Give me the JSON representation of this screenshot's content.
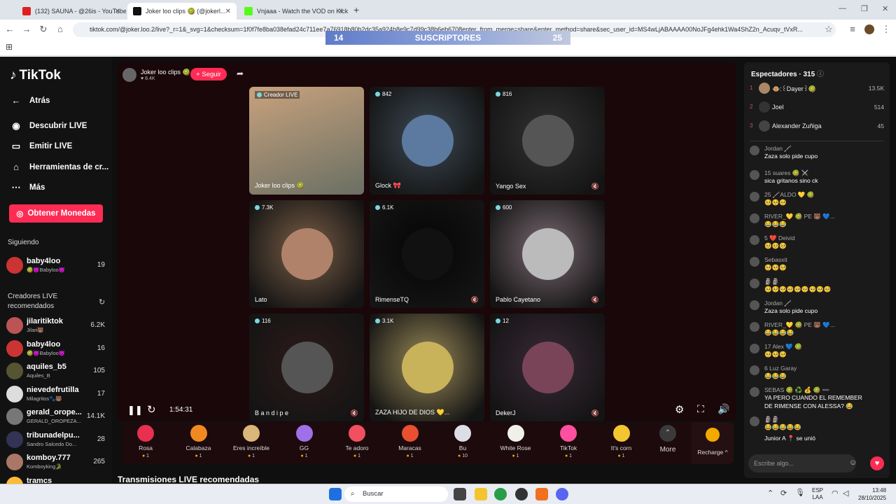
{
  "browser": {
    "tabs": [
      {
        "title": "(132) SAUNA - @26is - YouTube",
        "color": "#e02020"
      },
      {
        "title": "Joker loo clips 🥝 (@jokerl...",
        "color": "#111111"
      },
      {
        "title": "Vnjaaa - Watch the VOD on Kick",
        "color": "#53fc18"
      }
    ],
    "url": "tiktok.com/@joker.loo.2/live?_r=1&_svg=1&checksum=1f0f7fe8ba038efad24c711ee7a76918b80b2dc35a924b8e9c7d99c38b6eb6708enter_from_merge=share&enter_method=share&sec_user_id=MS4wLjABAAAA00NoJFg4ehk1Wa4ShZ2n_Acuqv_tVxR..."
  },
  "overlay": {
    "left_num": "14",
    "label": "SUSCRIPTORES",
    "right_num": "25"
  },
  "sidebar": {
    "logo": "TikTok",
    "nav": [
      {
        "label": "Atrás",
        "icon": "←"
      },
      {
        "label": "Descubrir LIVE",
        "icon": "◉"
      },
      {
        "label": "Emitir LIVE",
        "icon": "▭"
      },
      {
        "label": "Herramientas de cr...",
        "icon": "⌂"
      },
      {
        "label": "Más",
        "icon": "⋯"
      }
    ],
    "coins_label": "Obtener Monedas",
    "following_head": "Siguiendo",
    "following": [
      {
        "name": "baby4loo",
        "sub": "🥝😈Babyloo😈",
        "count": "19",
        "color": "#c33"
      }
    ],
    "rec_head": "Creadores LIVE recomendados",
    "recommended": [
      {
        "name": "jilaritiktok",
        "sub": "Jilari🐻",
        "count": "6.2K",
        "color": "#b55"
      },
      {
        "name": "baby4loo",
        "sub": "🥝😈Babyloo😈",
        "count": "16",
        "color": "#c33"
      },
      {
        "name": "aquiles_b5",
        "sub": "Aquiles_B",
        "count": "105",
        "color": "#553"
      },
      {
        "name": "nievedefrutilla",
        "sub": "Milagritos🐾🐻",
        "count": "17",
        "color": "#ddd"
      },
      {
        "name": "gerald_orope...",
        "sub": "GERALD_OROPEZA...",
        "count": "14.1K",
        "color": "#777"
      },
      {
        "name": "tribunadelpu...",
        "sub": "Sandro Salcedo Do...",
        "count": "28",
        "color": "#335"
      },
      {
        "name": "komboy.777",
        "sub": "Komboyking🐊",
        "count": "265",
        "color": "#a76"
      },
      {
        "name": "tramcs",
        "sub": "",
        "count": "",
        "color": "#fb3"
      }
    ]
  },
  "stream": {
    "host_name": "Joker loo clips 🥝",
    "host_likes": "♥ 8.4K",
    "follow_label": "+ Seguir",
    "tiles": [
      {
        "count": "",
        "label": "Creador LIVE",
        "name": "Joker loo clips 🥝",
        "muted": false,
        "bg": "#6a6f63",
        "pic": "#c8a27d"
      },
      {
        "count": "842",
        "label": "",
        "name": "Glock 🎀",
        "muted": false,
        "bg": "#3d4a55",
        "pic": "#5c7aa0"
      },
      {
        "count": "816",
        "label": "",
        "name": "Yango Sex",
        "muted": true,
        "bg": "#333",
        "pic": "#555"
      },
      {
        "count": "7.3K",
        "label": "",
        "name": "Lato",
        "muted": false,
        "bg": "#7a5e46",
        "pic": "#b0826a"
      },
      {
        "count": "6.1K",
        "label": "",
        "name": "RimenseTQ",
        "muted": true,
        "bg": "#050505",
        "pic": "#111"
      },
      {
        "count": "600",
        "label": "",
        "name": "Pablo Cayetano",
        "muted": true,
        "bg": "#7a6a72",
        "pic": "#bbb"
      },
      {
        "count": "116",
        "label": "",
        "name": "B a n d i p e",
        "muted": true,
        "bg": "#2e1a1a",
        "pic": "#555"
      },
      {
        "count": "3.1K",
        "label": "",
        "name": "ZAZA HIJO DE DIOS 💛...",
        "muted": false,
        "bg": "#9a8a58",
        "pic": "#c9b35a"
      },
      {
        "count": "12",
        "label": "",
        "name": "DekerJ",
        "muted": true,
        "bg": "#3a2a38",
        "pic": "#7a4458"
      }
    ],
    "time": "1:54:31",
    "rec_title": "Transmisiones LIVE recomendadas"
  },
  "gifts": [
    {
      "name": "Rosa",
      "price": "1",
      "color": "#e83050"
    },
    {
      "name": "Calabaza",
      "price": "1",
      "color": "#f08a20"
    },
    {
      "name": "Eres increíble",
      "price": "1",
      "color": "#d9b77a"
    },
    {
      "name": "GG",
      "price": "1",
      "color": "#a070e8"
    },
    {
      "name": "Te adoro",
      "price": "1",
      "color": "#f05060"
    },
    {
      "name": "Maracas",
      "price": "1",
      "color": "#e85030"
    },
    {
      "name": "Bu",
      "price": "10",
      "color": "#dddde8"
    },
    {
      "name": "White Rose",
      "price": "1",
      "color": "#f0f0e8"
    },
    {
      "name": "TikTok",
      "price": "1",
      "color": "#ff4fa0"
    },
    {
      "name": "It's corn",
      "price": "1",
      "color": "#f2c630"
    }
  ],
  "gift_more": "More",
  "gift_recharge": "Recharge ^",
  "chat": {
    "viewers_head": "Espectadores · 315",
    "top_viewers": [
      {
        "rank": "1",
        "name": "🐵:꒰Dayer꒱🥝",
        "count": "13.5K",
        "color": "#a86"
      },
      {
        "rank": "2",
        "name": "Joel",
        "count": "514",
        "color": "#333"
      },
      {
        "rank": "3",
        "name": "Alexander Zuñiga",
        "count": "45",
        "color": "#444"
      }
    ],
    "messages": [
      {
        "user": "Jordan 🦯",
        "text": "Zaza solo pide cupo"
      },
      {
        "user": "15 suares 🥝 ⚔️",
        "text": "sica gritanos sino ck"
      },
      {
        "user": "25 🦯ALDO 💛 🥝",
        "text": "🥺🥺🥺"
      },
      {
        "user": "RIVER_💛 🥝 PE 🐻 💙...",
        "text": "😂😂😂"
      },
      {
        "user": "5 ❤️ Deivid",
        "text": "🥺🥺🥺"
      },
      {
        "user": "Sebasxit",
        "text": "🥺🥺🥺"
      },
      {
        "user": "🗿🗿",
        "text": "🥺🥺🥺🥺🥺🥺🥺🥺🥺"
      },
      {
        "user": "Jordan 🦯",
        "text": "Zaza solo pide cupo"
      },
      {
        "user": "RIVER_💛 🥝 PE 🐻 💙...",
        "text": "😂😂😂😂"
      },
      {
        "user": "17 Alex 💙 🥝",
        "text": "🥺🥺🥺"
      },
      {
        "user": "6 Luz Garay",
        "text": "😂😂😂"
      },
      {
        "user": "SEBAS 🥝 ♻️ 💰 🥝 ➖",
        "text": "YA PERO CUANDO EL REMEMBER"
      },
      {
        "user": "🗿🗿",
        "text": "😂😂😂😂😂"
      }
    ],
    "extra_line": "DE RIMENSE CON ALESSA? 😂",
    "joined": "Junior A 📍 se unió",
    "input_placeholder": "Escribe algo..."
  },
  "taskbar": {
    "search": "Buscar",
    "lang1": "ESP",
    "lang2": "LAA",
    "time": "13:48",
    "date": "28/10/2025"
  }
}
